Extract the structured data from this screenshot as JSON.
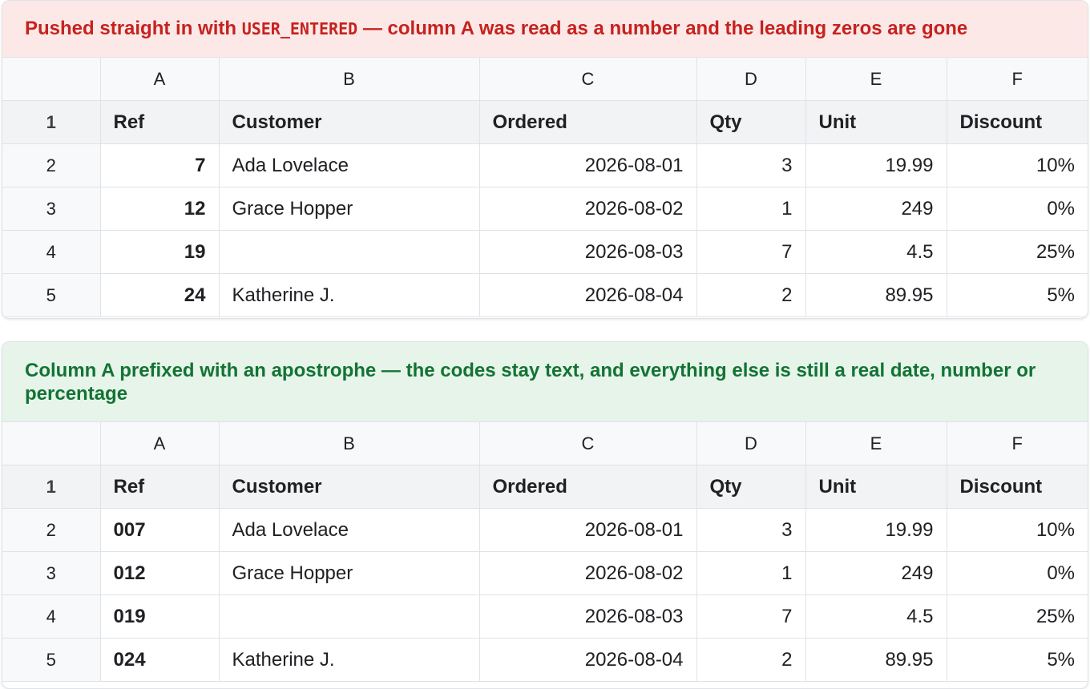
{
  "bad": {
    "banner_pre": "Pushed straight in with ",
    "banner_code": "USER_ENTERED",
    "banner_post": " — column A was read as a number and the leading zeros are gone",
    "refs": [
      "7",
      "12",
      "19",
      "24"
    ],
    "accent": "#c5221f"
  },
  "good": {
    "banner": "Column A prefixed with an apostrophe — the codes stay text, and everything else is still a real date, number or percentage",
    "refs": [
      "007",
      "012",
      "019",
      "024"
    ],
    "accent": "#137333"
  },
  "columns": [
    "A",
    "B",
    "C",
    "D",
    "E",
    "F"
  ],
  "headers": [
    "Ref",
    "Customer",
    "Ordered",
    "Qty",
    "Unit",
    "Discount"
  ],
  "row_numbers": [
    "1",
    "2",
    "3",
    "4",
    "5"
  ],
  "rows": [
    {
      "customer": "Ada Lovelace",
      "ordered": "2026-08-01",
      "qty": "3",
      "unit": "19.99",
      "discount": "10%"
    },
    {
      "customer": "Grace Hopper",
      "ordered": "2026-08-02",
      "qty": "1",
      "unit": "249",
      "discount": "0%"
    },
    {
      "customer": "",
      "ordered": "2026-08-03",
      "qty": "7",
      "unit": "4.5",
      "discount": "25%"
    },
    {
      "customer": "Katherine J.",
      "ordered": "2026-08-04",
      "qty": "2",
      "unit": "89.95",
      "discount": "5%"
    }
  ]
}
